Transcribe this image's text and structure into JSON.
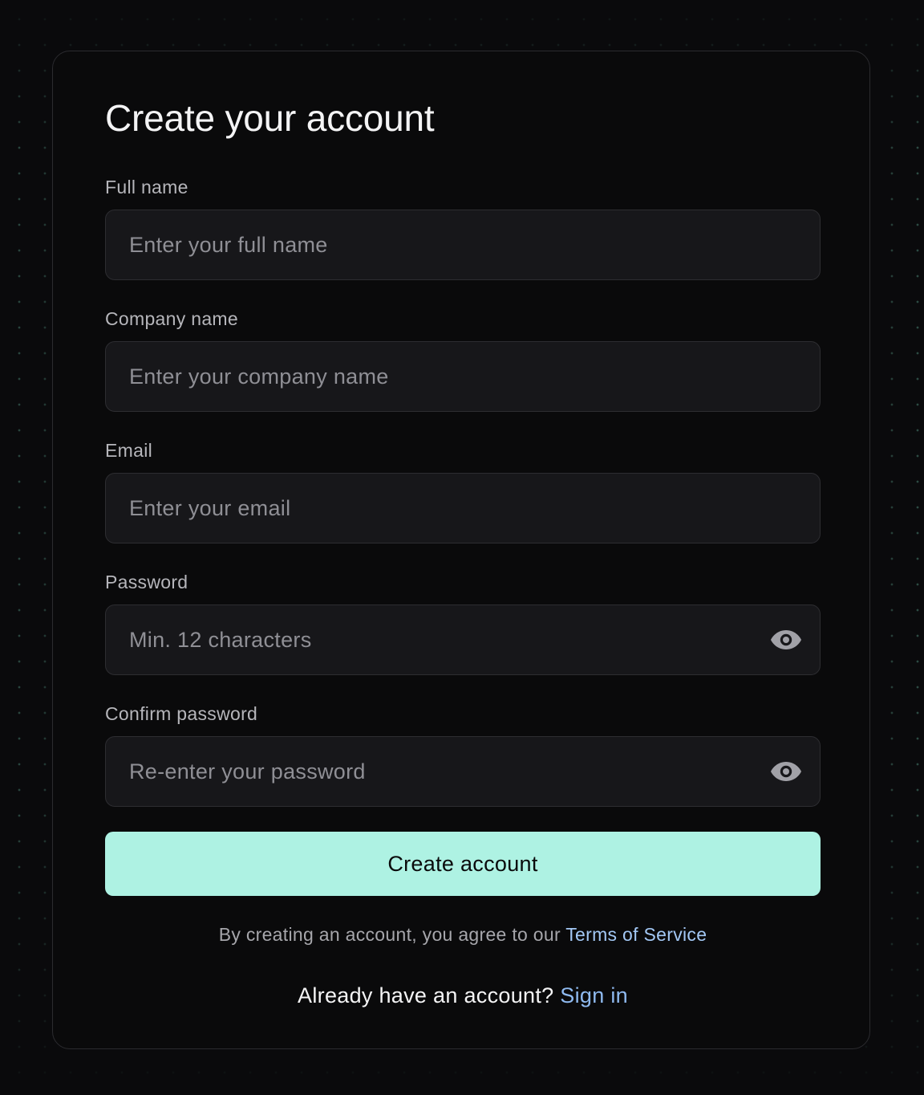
{
  "form": {
    "title": "Create your account",
    "fields": [
      {
        "label": "Full name",
        "placeholder": "Enter your full name",
        "value": ""
      },
      {
        "label": "Company name",
        "placeholder": "Enter your company name",
        "value": ""
      },
      {
        "label": "Email",
        "placeholder": "Enter your email",
        "value": ""
      },
      {
        "label": "Password",
        "placeholder": "Min. 12 characters",
        "value": "",
        "icon": "eye-icon"
      },
      {
        "label": "Confirm password",
        "placeholder": "Re-enter your password",
        "value": "",
        "icon": "eye-icon"
      }
    ],
    "submit_label": "Create account",
    "terms": {
      "prefix": "By creating an account, you agree to our",
      "link": "Terms of Service"
    },
    "signin": {
      "prefix": "Already have an account?",
      "link": "Sign in"
    }
  },
  "colors": {
    "background": "#0a0a0c",
    "dot_accent": "#6ec8af",
    "card_border": "#2b2b2f",
    "input_background": "#17171a",
    "button_background": "#aef2e3",
    "link": "#a3c8f5"
  }
}
